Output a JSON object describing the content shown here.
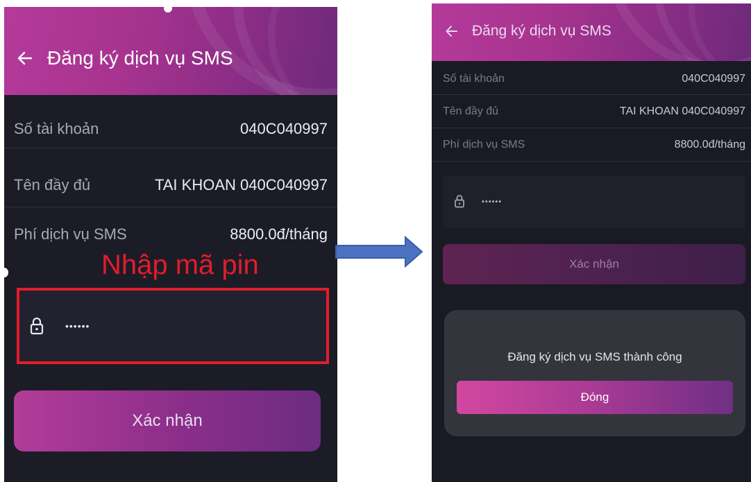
{
  "left_screen": {
    "title": "Đăng ký dịch vụ SMS",
    "rows": [
      {
        "label": "Số tài khoản",
        "value": "040C040997"
      },
      {
        "label": "Tên đầy đủ",
        "value": "TAI KHOAN 040C040997"
      },
      {
        "label": "Phí dịch vụ SMS",
        "value": "8800.0đ/tháng"
      }
    ],
    "annotation": "Nhập mã pin",
    "pin_value": "••••••",
    "confirm_label": "Xác nhận"
  },
  "right_screen": {
    "title": "Đăng ký dịch vụ SMS",
    "rows": [
      {
        "label": "Số tài khoản",
        "value": "040C040997"
      },
      {
        "label": "Tên đầy đủ",
        "value": "TAI KHOAN 040C040997"
      },
      {
        "label": "Phí dịch vụ SMS",
        "value": "8800.0đ/tháng"
      }
    ],
    "pin_value": "••••••",
    "confirm_label": "Xác nhận",
    "dialog": {
      "message": "Đăng ký dịch vụ SMS thành công",
      "close_label": "Đóng"
    }
  },
  "colors": {
    "accent_pink": "#c23f9c",
    "accent_purple": "#6c2c80",
    "background": "#1c1c27",
    "annotation_red": "#e21d2a",
    "arrow_blue": "#4a72c0"
  },
  "icons": [
    "arrow-left-icon",
    "lock-icon",
    "right-arrow-icon"
  ]
}
